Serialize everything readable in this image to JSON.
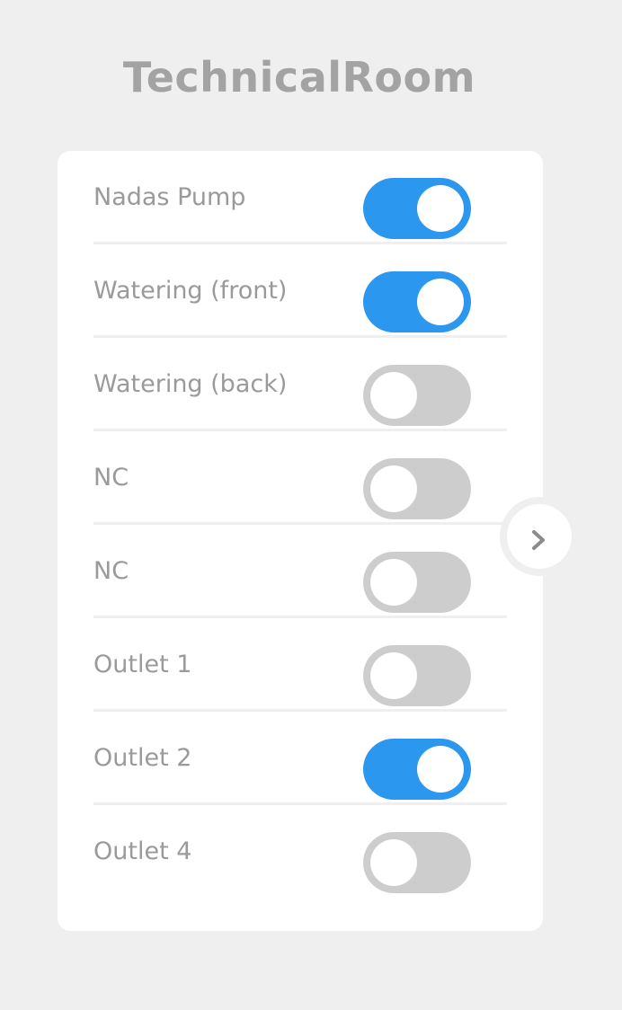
{
  "page": {
    "title": "TechnicalRoom"
  },
  "switches": [
    {
      "label": "Nadas Pump",
      "on": true
    },
    {
      "label": "Watering (front)",
      "on": true
    },
    {
      "label": "Watering (back)",
      "on": false
    },
    {
      "label": "NC",
      "on": false
    },
    {
      "label": "NC",
      "on": false
    },
    {
      "label": "Outlet 1",
      "on": false
    },
    {
      "label": "Outlet 2",
      "on": true
    },
    {
      "label": "Outlet 4",
      "on": false
    }
  ],
  "navigation": {
    "next_icon": "chevron-right-icon"
  },
  "colors": {
    "background": "#efefef",
    "card": "#ffffff",
    "toggle_on": "#2b97ef",
    "toggle_off": "#cdcdcd",
    "text": "#9a9a9a",
    "title": "#a3a3a3"
  }
}
